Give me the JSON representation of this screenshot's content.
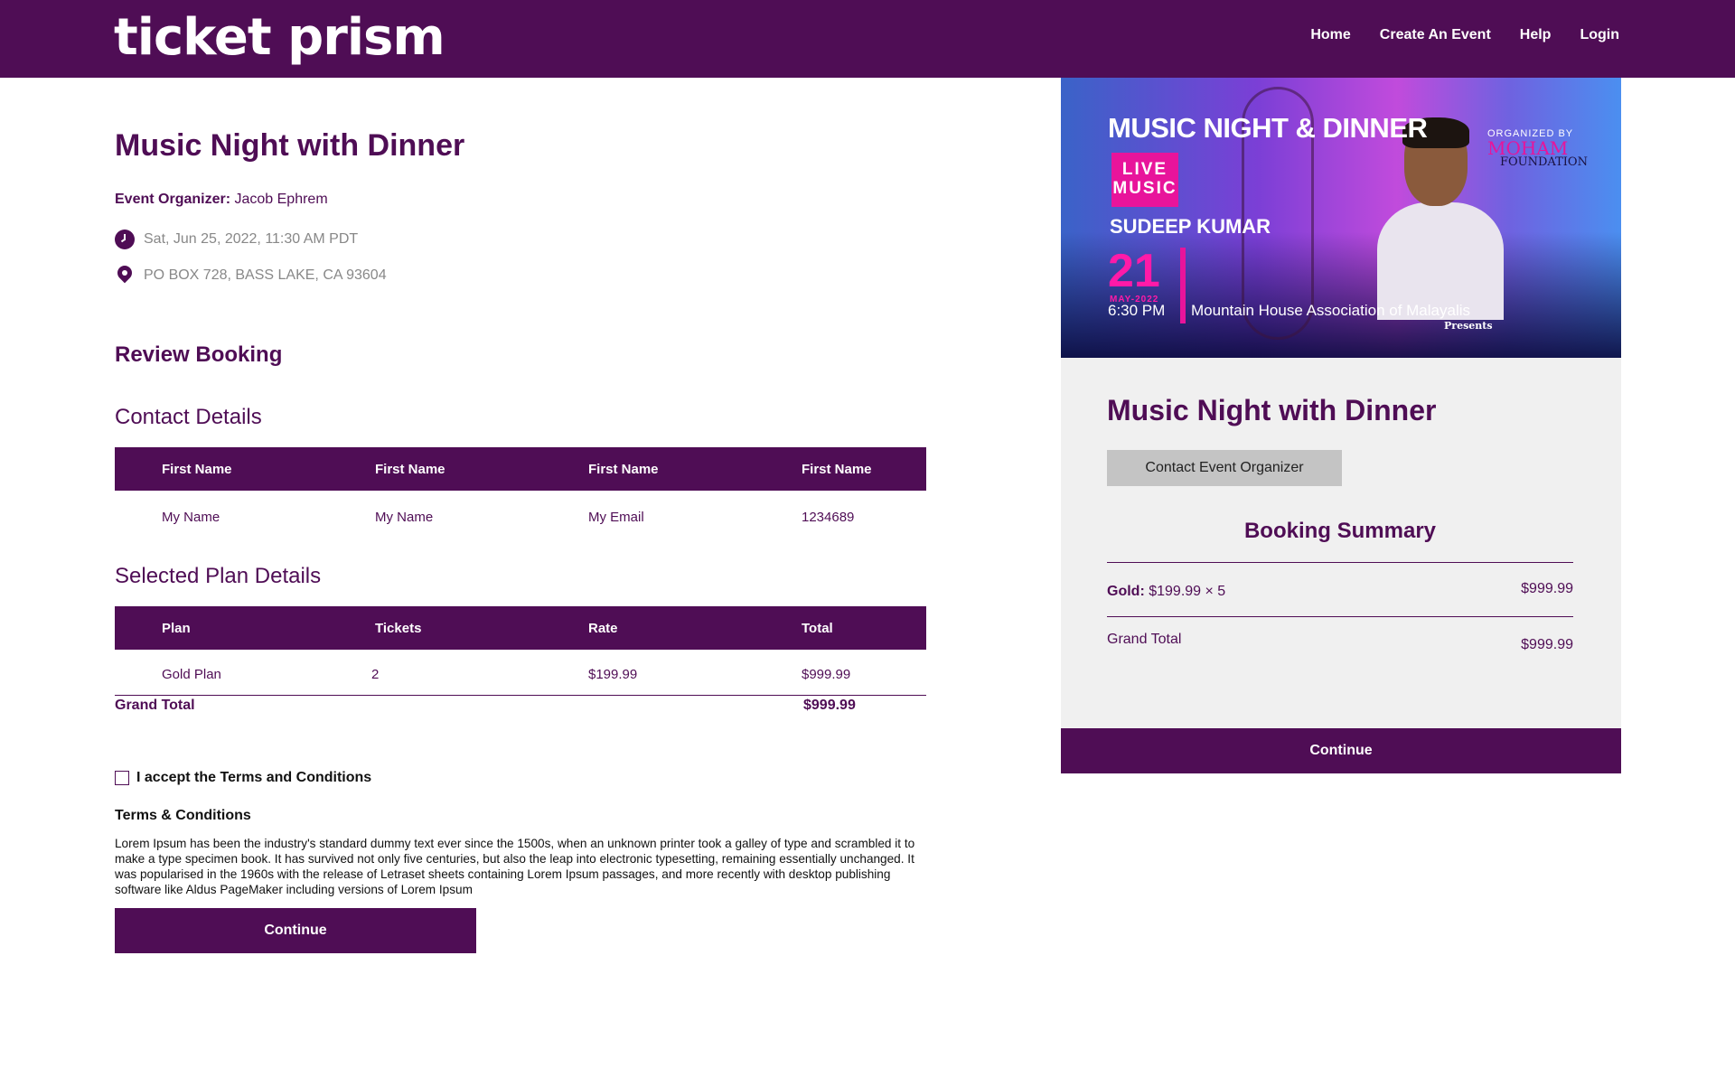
{
  "header": {
    "logo": "ticket prism",
    "nav": [
      "Home",
      "Create An Event",
      "Help",
      "Login"
    ]
  },
  "event": {
    "title": "Music Night with Dinner",
    "organizer_label": "Event Organizer:",
    "organizer_name": "Jacob Ephrem",
    "date": "Sat, Jun 25, 2022, 11:30 AM PDT",
    "location": "PO BOX 728, BASS LAKE, CA 93604"
  },
  "review": {
    "heading": "Review Booking",
    "contact_heading": "Contact Details",
    "contact_columns": [
      "First Name",
      "First Name",
      "First Name",
      "First Name"
    ],
    "contact_values": [
      "My Name",
      "My Name",
      "My Email",
      "1234689"
    ],
    "plan_heading": "Selected Plan Details",
    "plan_columns": [
      "Plan",
      "Tickets",
      "Rate",
      "Total"
    ],
    "plan_values": [
      "Gold Plan",
      "2",
      "$199.99",
      "$999.99"
    ],
    "grand_total_label": "Grand Total",
    "grand_total_value": "$999.99",
    "terms_checkbox_label": "I accept the Terms and Conditions",
    "terms_checked": false,
    "terms_heading": "Terms & Conditions",
    "terms_text": "Lorem Ipsum has been the industry's standard dummy text ever since the 1500s, when an unknown printer took a galley of type and scrambled it to make a type specimen book. It has survived not only five centuries, but also the leap into electronic typesetting, remaining essentially unchanged. It was popularised in the 1960s with the release of Letraset sheets containing Lorem Ipsum passages, and more recently with desktop publishing software like Aldus PageMaker including versions of Lorem Ipsum",
    "continue_label": "Continue"
  },
  "banner": {
    "title": "MUSIC NIGHT & DINNER",
    "live_music": "LIVE MUSIC",
    "artist": "SUDEEP KUMAR",
    "day": "21",
    "month": "MAY-2022",
    "time": "6:30 PM",
    "presenter": "Mountain House Association of Malayalis",
    "presents": "Presents",
    "organized_by_label": "ORGANIZED BY",
    "organized_by_name": "MOHAM",
    "organized_by_suffix": "FOUNDATION"
  },
  "sidebar": {
    "title": "Music Night with Dinner",
    "contact_button": "Contact Event Organizer",
    "summary_heading": "Booking Summary",
    "line_item_label": "Gold:",
    "line_item_detail": "$199.99 × 5",
    "line_item_amount": "$999.99",
    "grand_total_label": "Grand Total",
    "grand_total_amount": "$999.99",
    "continue_label": "Continue"
  },
  "colors": {
    "brand": "#4f0d55",
    "card_bg": "#f0f0f0",
    "secondary_button": "#c4c4c4",
    "accent_pink": "#e8149b"
  }
}
